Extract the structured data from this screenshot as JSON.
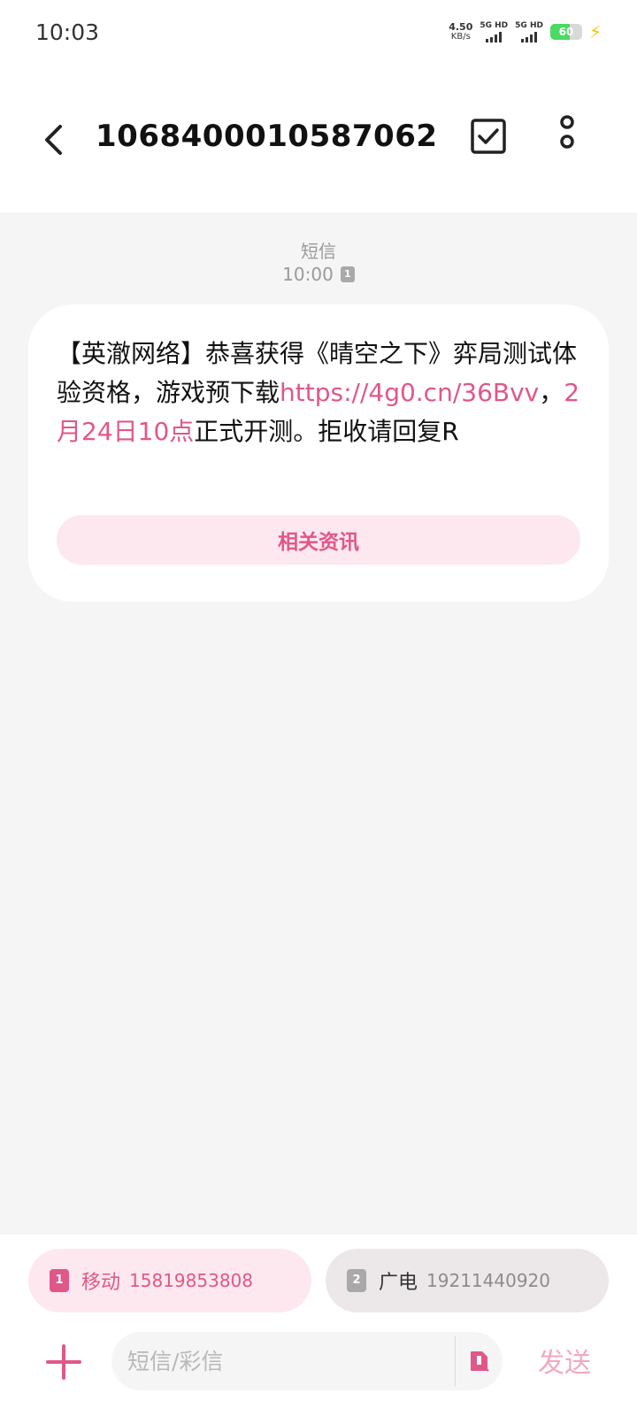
{
  "status": {
    "time": "10:03",
    "speed_value": "4.50",
    "speed_unit": "KB/s",
    "sig1": "5G HD",
    "sig2": "5G HD",
    "battery": "60"
  },
  "header": {
    "title": "1068400010587062"
  },
  "chat": {
    "type_label": "短信",
    "time": "10:00",
    "sim_tag": "1",
    "message": {
      "text_part1": "【英澈网络】恭喜获得《晴空之下》弈局测试体验资格，游戏预下载",
      "link": "https://4g0.cn/36Bvv",
      "sep": "，",
      "date_link": "2月24日10点",
      "text_part2": "正式开测。拒收请回复R"
    },
    "related_button": "相关资讯"
  },
  "bottom": {
    "sim1": {
      "badge": "1",
      "name": "移动",
      "number": "15819853808"
    },
    "sim2": {
      "badge": "2",
      "name": "广电",
      "number": "19211440920"
    },
    "input_placeholder": "短信/彩信",
    "send_label": "发送"
  },
  "colors": {
    "accent": "#e0578a",
    "accent_light": "#fce8ee",
    "chat_bg": "#f5f5f6"
  }
}
